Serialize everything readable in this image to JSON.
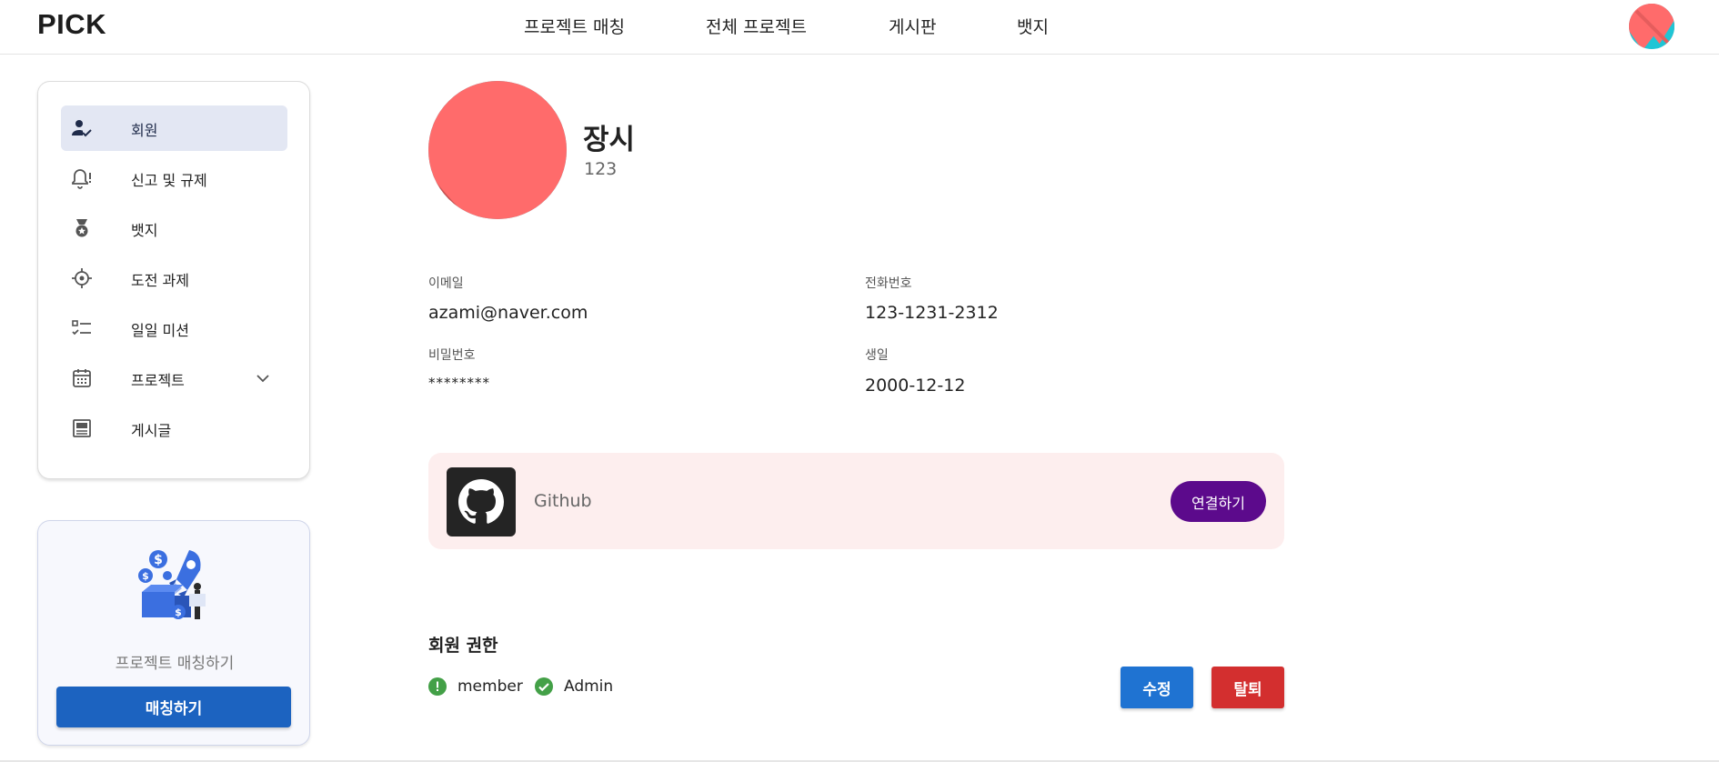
{
  "header": {
    "logo": "PICK",
    "nav": [
      "프로젝트 매칭",
      "전체 프로젝트",
      "게시판",
      "뱃지"
    ]
  },
  "sidebar": {
    "items": [
      {
        "label": "회원",
        "icon": "user-check-icon",
        "active": true
      },
      {
        "label": "신고 및 규제",
        "icon": "bell-alert-icon"
      },
      {
        "label": "뱃지",
        "icon": "medal-icon"
      },
      {
        "label": "도전 과제",
        "icon": "crosshair-icon"
      },
      {
        "label": "일일 미션",
        "icon": "checklist-icon"
      },
      {
        "label": "프로젝트",
        "icon": "calendar-icon",
        "expandable": true
      },
      {
        "label": "게시글",
        "icon": "article-icon"
      }
    ],
    "promo": {
      "text": "프로젝트 매칭하기",
      "button": "매칭하기"
    }
  },
  "profile": {
    "name": "장시",
    "sub": "123",
    "fields": {
      "email_label": "이메일",
      "email": "azami@naver.com",
      "phone_label": "전화번호",
      "phone": "123-1231-2312",
      "password_label": "비밀번호",
      "password": "********",
      "birthday_label": "생일",
      "birthday": "2000-12-12"
    }
  },
  "github": {
    "name": "Github",
    "connect_button": "연결하기"
  },
  "roles": {
    "title": "회원 권한",
    "items": [
      {
        "label": "member",
        "status": "warning"
      },
      {
        "label": "Admin",
        "status": "checked"
      }
    ],
    "edit_button": "수정",
    "delete_button": "탈퇴"
  },
  "colors": {
    "primary": "#1c63c0",
    "github_connect": "#5c0a8c",
    "delete": "#d32f2f",
    "edit": "#1f73d2",
    "avatar_coral": "#ff6b6b",
    "avatar_teal": "#1fc5d5",
    "role_green": "#43a047"
  }
}
